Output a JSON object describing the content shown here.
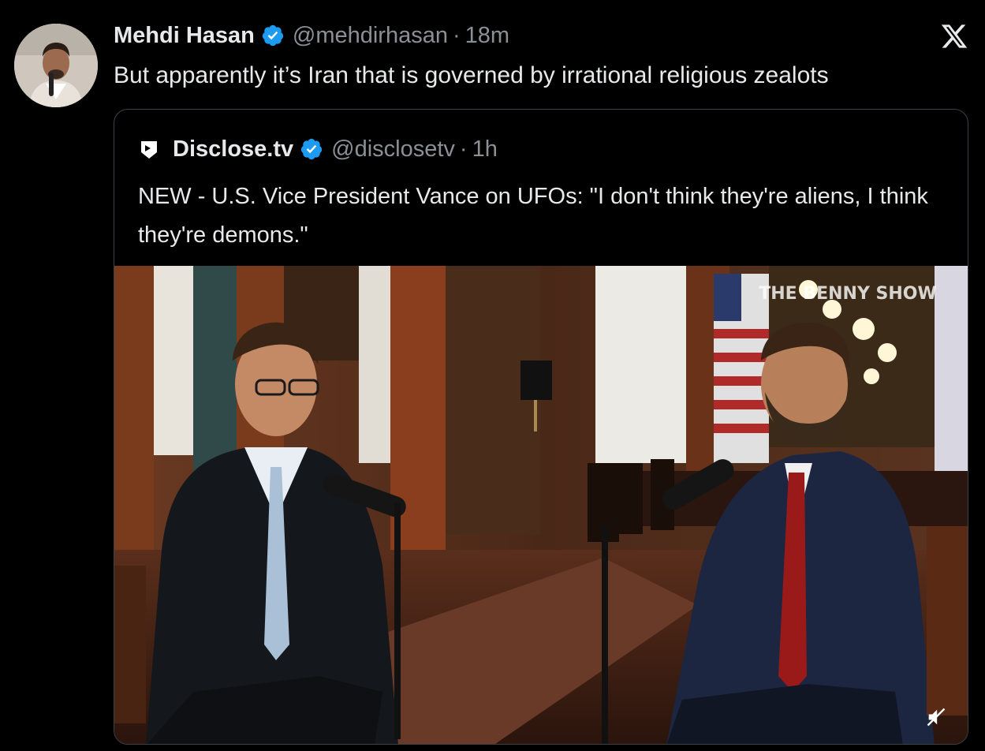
{
  "tweet": {
    "author_name": "Mehdi Hasan",
    "handle": "@mehdirhasan",
    "separator": "·",
    "time": "18m",
    "text": "But apparently it’s Iran that is governed by irrational religious zealots",
    "verified_icon": "verified-badge-icon",
    "platform_icon": "x-logo-icon"
  },
  "quoted_tweet": {
    "author_name": "Disclose.tv",
    "handle": "@disclosetv",
    "separator": "·",
    "time": "1h",
    "text": "NEW - U.S. Vice President Vance on UFOs: \"I don't think they're aliens, I think they're demons.\"",
    "media": {
      "watermark": "THE BENNY SHOW",
      "mute_icon": "muted-speaker-icon"
    }
  },
  "colors": {
    "background": "#000000",
    "text_primary": "#e7e9ea",
    "text_secondary": "#8b9096",
    "verified_blue": "#1d9bf0",
    "border": "#3d4247"
  }
}
